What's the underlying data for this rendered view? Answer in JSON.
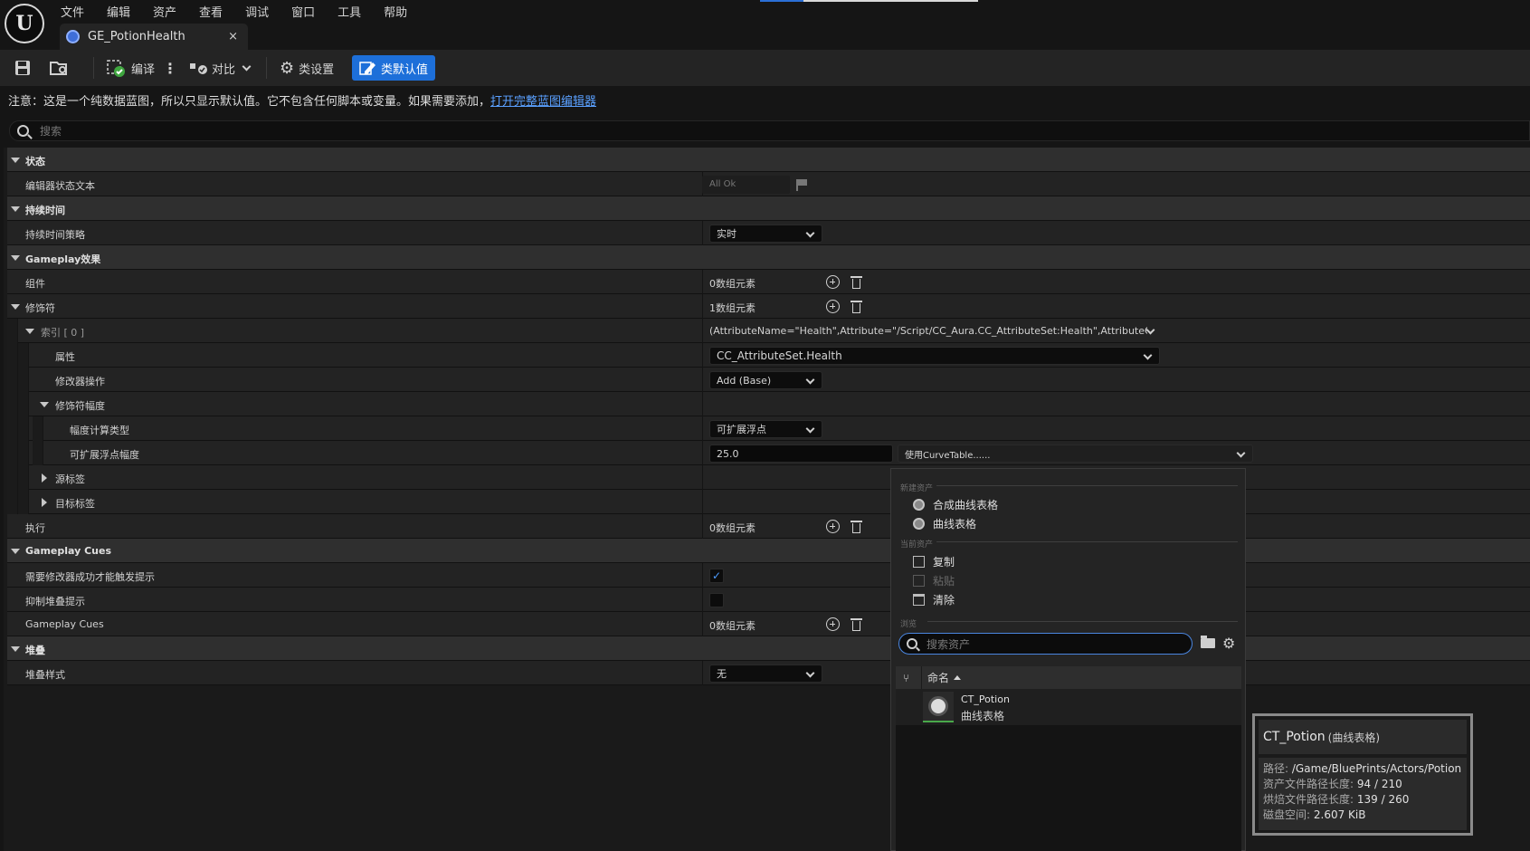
{
  "menubar": [
    "文件",
    "编辑",
    "资产",
    "查看",
    "调试",
    "窗口",
    "工具",
    "帮助"
  ],
  "tab": {
    "title": "GE_PotionHealth",
    "close": "×"
  },
  "toolbar": {
    "compile": "编译",
    "diff": "对比",
    "class_settings": "类设置",
    "class_defaults": "类默认值"
  },
  "notice": {
    "text": "注意：这是一个纯数据蓝图，所以只显示默认值。它不包含任何脚本或变量。如果需要添加，",
    "link": "打开完整蓝图编辑器"
  },
  "search": {
    "placeholder": "搜索"
  },
  "details": {
    "cat_status": "状态",
    "editor_status_text": "编辑器状态文本",
    "editor_status_value": "All Ok",
    "cat_duration": "持续时间",
    "duration_policy": "持续时间策略",
    "duration_policy_value": "实时",
    "cat_gameplay_effect": "Gameplay效果",
    "components": "组件",
    "components_value": "0数组元素",
    "cat_modifiers": "修饰符",
    "modifiers_value": "1数组元素",
    "index0": "索引 [ 0 ]",
    "index0_value": "(AttributeName=\"Health\",Attribute=\"/Script/CC_Aura.CC_AttributeSet:Health\",AttributeOwne",
    "attribute": "属性",
    "attribute_value": "CC_AttributeSet.Health",
    "modifier_op": "修改器操作",
    "modifier_op_value": "Add (Base)",
    "modifier_magnitude": "修饰符幅度",
    "magnitude_calc_type": "幅度计算类型",
    "magnitude_calc_type_value": "可扩展浮点",
    "scalable_float_magnitude": "可扩展浮点幅度",
    "scalable_float_value": "25.0",
    "curve_table_value": "使用CurveTable......",
    "source_tags": "源标签",
    "target_tags": "目标标签",
    "executions": "执行",
    "executions_value": "0数组元素",
    "cat_gameplay_cues": "Gameplay Cues",
    "require_modifier_success": "需要修改器成功才能触发提示",
    "require_modifier_success_checked": true,
    "suppress_stacking_cues": "抑制堆叠提示",
    "suppress_stacking_cues_checked": false,
    "gameplay_cues": "Gameplay Cues",
    "gameplay_cues_value": "0数组元素",
    "cat_stacking": "堆叠",
    "stacking_type": "堆叠样式",
    "stacking_type_value": "无"
  },
  "dropdown": {
    "section_new": "新建资产",
    "new_composite": "合成曲线表格",
    "new_curve_table": "曲线表格",
    "section_current": "当前资产",
    "copy": "复制",
    "paste": "粘贴",
    "clear": "清除",
    "section_browse": "浏览",
    "search_placeholder": "搜索资产",
    "column_name": "命名",
    "asset_name": "CT_Potion",
    "asset_type": "曲线表格"
  },
  "tooltip": {
    "title": "CT_Potion",
    "subtitle": "(曲线表格)",
    "path_label": "路径:",
    "path_value": "/Game/BluePrints/Actors/Potion",
    "asset_path_len_label": "资产文件路径长度:",
    "asset_path_len_value": "94 / 210",
    "cooked_path_len_label": "烘焙文件路径长度:",
    "cooked_path_len_value": "139 / 260",
    "disk_label": "磁盘空间:",
    "disk_value": "2.607 KiB"
  },
  "colors": {
    "accent": "#1d6fd9",
    "link": "#5aa0ff",
    "check": "#4d9cff"
  }
}
